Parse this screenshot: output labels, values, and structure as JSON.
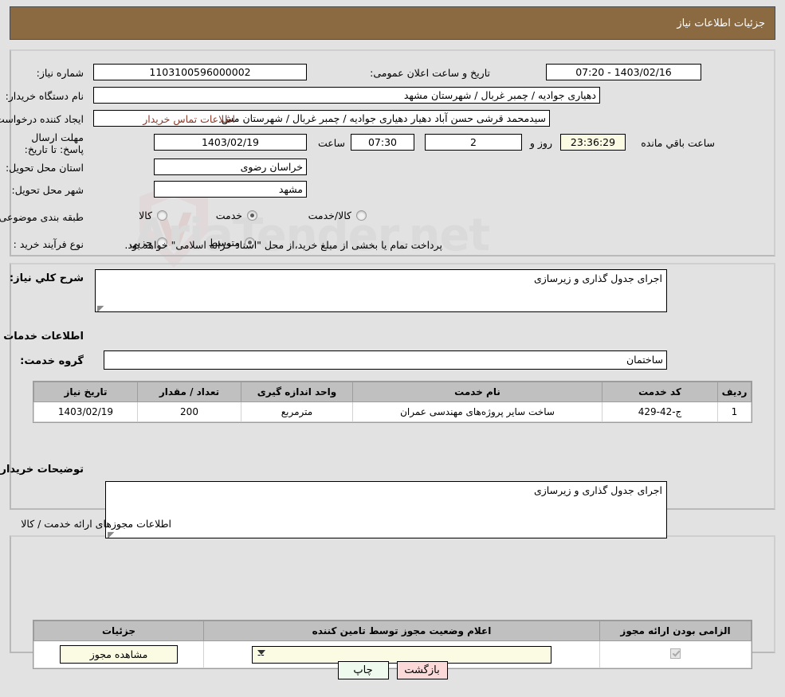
{
  "header": {
    "title": "جزئیات اطلاعات نیاز"
  },
  "top_form": {
    "need_number_label": "شماره نیاز:",
    "need_number_value": "1103100596000002",
    "announce_label": "تاریخ و ساعت اعلان عمومی:",
    "announce_value": "1403/02/16 - 07:20",
    "buyer_org_label": "نام دستگاه خریدار:",
    "buyer_org_value": "دهیاری جوادیه / چمبر غربال / شهرستان مشهد",
    "creator_label": "ایجاد کننده درخواست:",
    "creator_value": "سیدمحمد قرشی حسن آباد دهیار دهیاری جوادیه / چمبر غربال / شهرستان مش",
    "contact_link": "اطلاعات تماس خریدار",
    "deadline_label": "مهلت ارسال پاسخ: تا تاریخ:",
    "deadline_date": "1403/02/19",
    "hour_label": "ساعت",
    "deadline_time": "07:30",
    "days_value": "2",
    "days_label": "روز و",
    "countdown_value": "23:36:29",
    "remaining_label": "ساعت باقي مانده",
    "province_label": "استان محل تحویل:",
    "province_value": "خراسان رضوی",
    "city_label": "شهر محل تحویل:",
    "city_value": "مشهد",
    "category_label": "طبقه بندی موضوعی:",
    "category_options": [
      {
        "label": "کالا",
        "selected": false
      },
      {
        "label": "خدمت",
        "selected": true
      },
      {
        "label": "کالا/خدمت",
        "selected": false
      }
    ],
    "purchase_type_label": "نوع فرآیند خرید :",
    "purchase_type_options": [
      {
        "label": "جزیي",
        "selected": false
      },
      {
        "label": "متوسط",
        "selected": true
      }
    ],
    "payment_note": "پرداخت تمام یا بخشی از مبلغ خرید،از محل \"اسناد خزانه اسلامی\" خواهد بود."
  },
  "middle": {
    "general_desc_label": "شرح کلي نیاز:",
    "general_desc_value": "اجرای جدول گذاری و زیرسازی",
    "services_info_title": "اطلاعات خدمات مورد نیاز",
    "service_group_label": "گروه خدمت:",
    "service_group_value": "ساختمان",
    "table": {
      "columns": [
        "ردیف",
        "کد خدمت",
        "نام خدمت",
        "واحد اندازه گیری",
        "تعداد / مقدار",
        "تاریخ نیاز"
      ],
      "rows": [
        {
          "row": "1",
          "code": "ج-42-429",
          "name": "ساخت سایر پروژه‌های مهندسی عمران",
          "unit": "مترمربع",
          "qty": "200",
          "date": "1403/02/19"
        }
      ]
    },
    "buyer_notes_label": "توضیحات خریدار:",
    "buyer_notes_value": "اجرای جدول گذاری و زیرسازی"
  },
  "permits": {
    "section_title": "اطلاعات مجوزهای ارائه خدمت / کالا",
    "table": {
      "columns": [
        "الزامی بودن ارائه مجوز",
        "اعلام وضعیت مجوز توسط تامین کننده",
        "جزئیات"
      ],
      "rows": [
        {
          "required_checked": true,
          "status_value": "--",
          "details_button": "مشاهده مجوز"
        }
      ]
    }
  },
  "footer": {
    "print_label": "چاپ",
    "back_label": "بازگشت"
  },
  "watermark": {
    "text": "AriaTender.net"
  },
  "colors": {
    "header_bg": "#8b6a42",
    "page_bg": "#e2e2e2",
    "link": "#8b3a2a",
    "highlight": "#fbfbe4",
    "print_btn": "#edfaed",
    "back_btn": "#fbd9d9"
  }
}
